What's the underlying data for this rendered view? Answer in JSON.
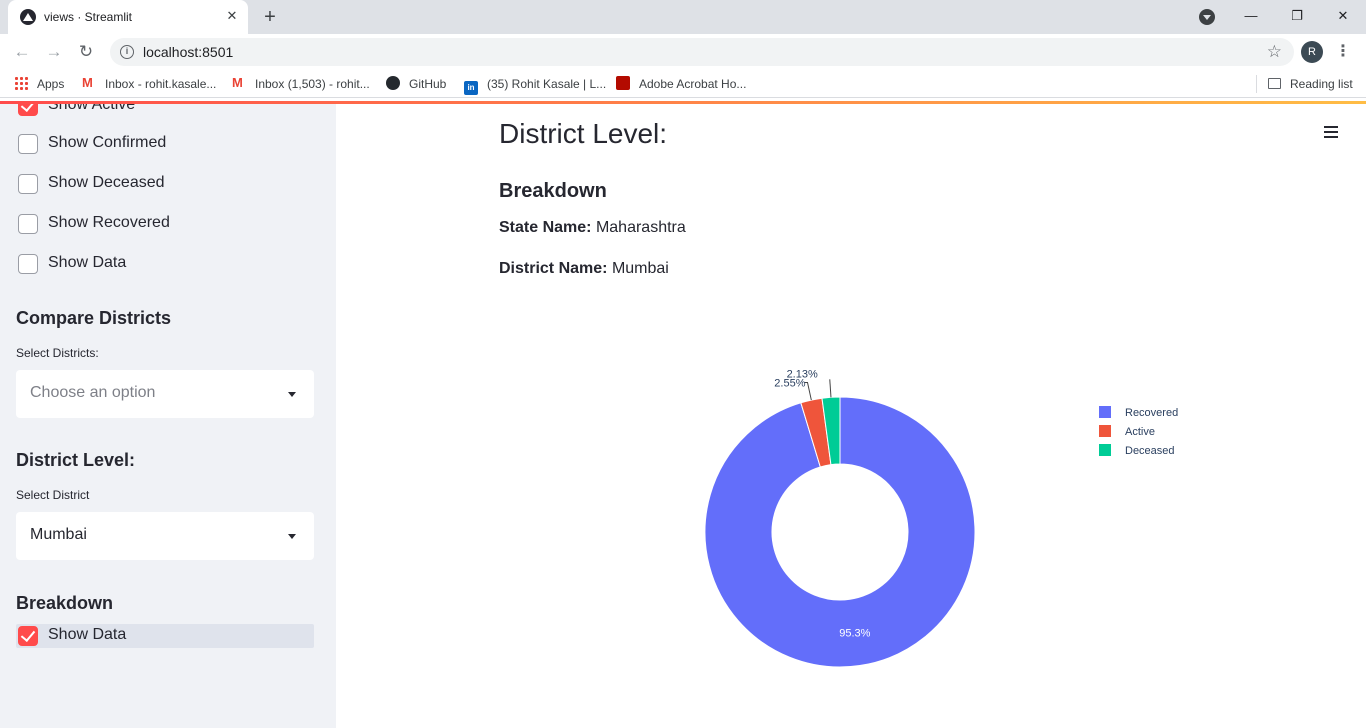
{
  "browser": {
    "tab_title": "views · Streamlit",
    "url": "localhost:8501",
    "profile_initial": "R",
    "bookmarks": [
      {
        "label": "Apps",
        "icon": "apps-grid-icon"
      },
      {
        "label": "Inbox - rohit.kasale...",
        "icon": "gmail-icon"
      },
      {
        "label": "Inbox (1,503) - rohit...",
        "icon": "gmail-icon"
      },
      {
        "label": "GitHub",
        "icon": "github-icon"
      },
      {
        "label": "(35) Rohit Kasale | L...",
        "icon": "linkedin-icon"
      },
      {
        "label": "Adobe Acrobat Ho...",
        "icon": "adobe-icon"
      }
    ],
    "reading_list": "Reading list"
  },
  "sidebar": {
    "checkboxes": [
      {
        "label": "Show Active",
        "checked": true
      },
      {
        "label": "Show Confirmed",
        "checked": false
      },
      {
        "label": "Show Deceased",
        "checked": false
      },
      {
        "label": "Show Recovered",
        "checked": false
      },
      {
        "label": "Show Data",
        "checked": false
      }
    ],
    "compare": {
      "heading": "Compare Districts",
      "label": "Select Districts:",
      "placeholder": "Choose an option"
    },
    "district": {
      "heading": "District Level:",
      "label": "Select District",
      "value": "Mumbai"
    },
    "breakdown": {
      "heading": "Breakdown",
      "checkbox_label": "Show Data",
      "checked": true
    }
  },
  "main": {
    "title": "District Level:",
    "subheading": "Breakdown",
    "state_key": "State Name:",
    "state_value": "Maharashtra",
    "district_key": "District Name:",
    "district_value": "Mumbai"
  },
  "chart_data": {
    "type": "pie",
    "hole": true,
    "labels": [
      "Recovered",
      "Active",
      "Deceased"
    ],
    "values": [
      95.3,
      2.55,
      2.13
    ],
    "display_labels": [
      "95.3%",
      "2.55%",
      "2.13%"
    ],
    "colors": [
      "#636efa",
      "#ef553b",
      "#00cc96"
    ],
    "legend_position": "right"
  }
}
